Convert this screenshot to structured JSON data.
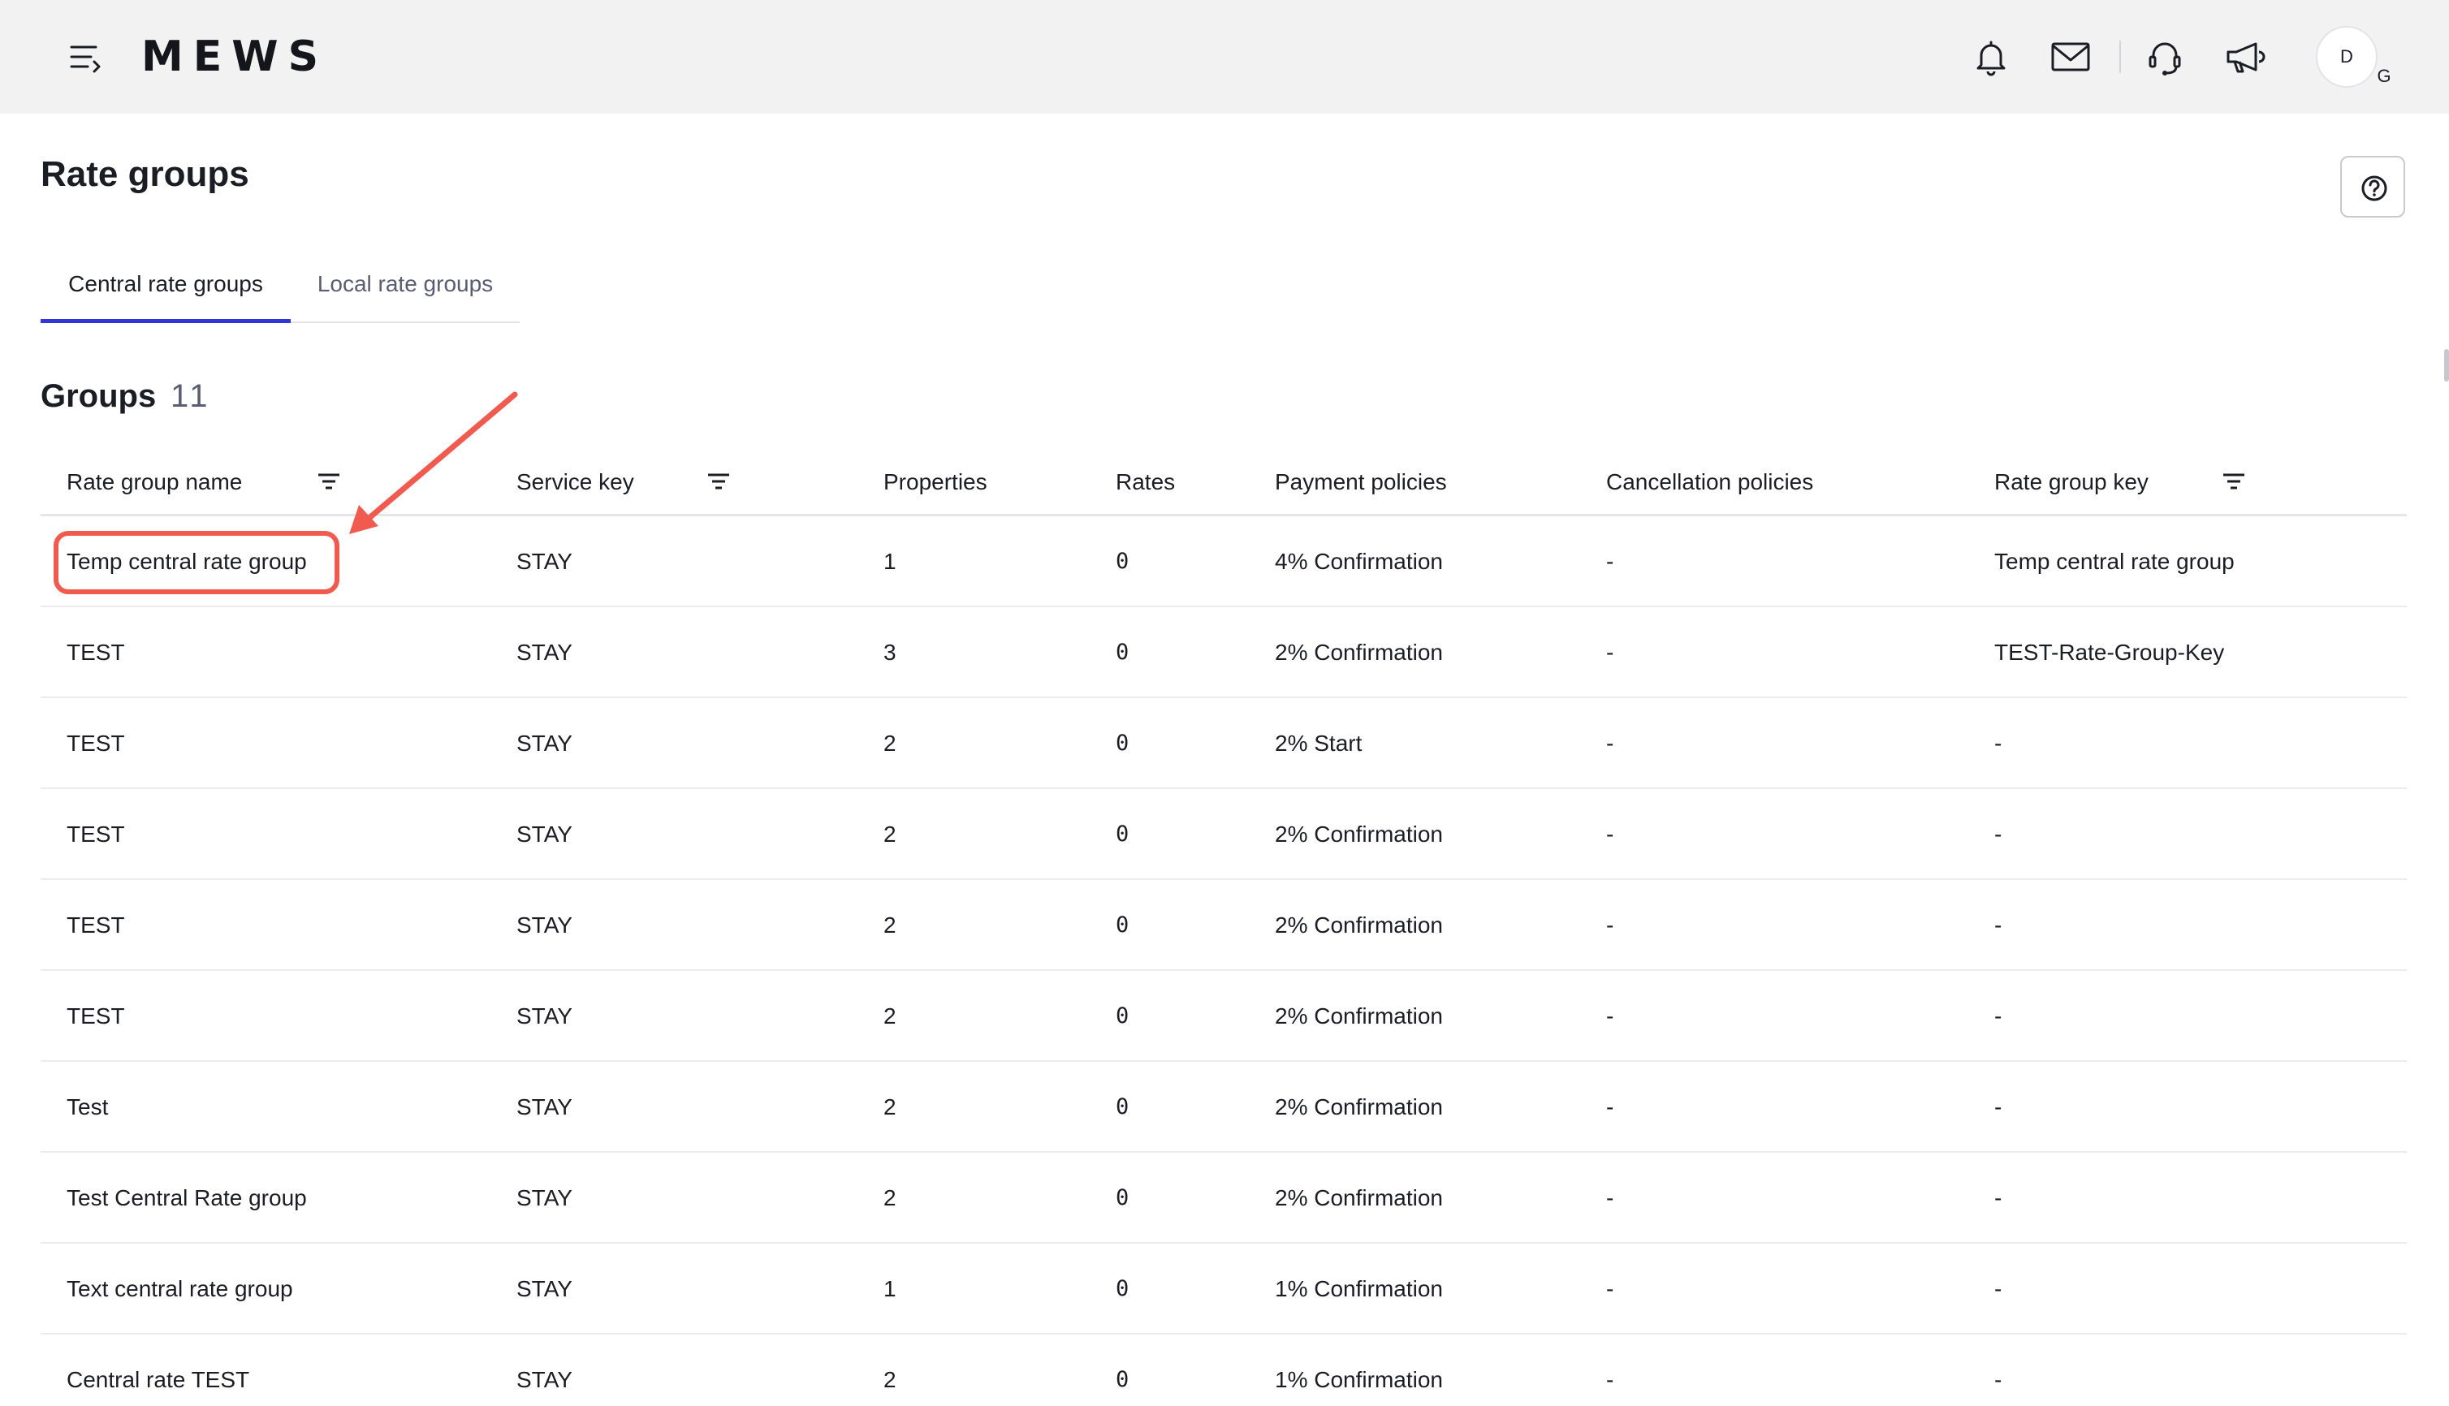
{
  "header": {
    "brand": "MEWS",
    "avatar_initial": "D",
    "avatar_sub": "G",
    "icons": [
      "menu-icon",
      "bell-icon",
      "mail-icon",
      "headset-icon",
      "megaphone-icon"
    ]
  },
  "page": {
    "title": "Rate groups"
  },
  "tabs": [
    {
      "label": "Central rate groups",
      "active": true
    },
    {
      "label": "Local rate groups",
      "active": false
    }
  ],
  "groups": {
    "title": "Groups",
    "count": "11"
  },
  "table": {
    "columns": [
      "Rate group name",
      "Service key",
      "Properties",
      "Rates",
      "Payment policies",
      "Cancellation policies",
      "Rate group key"
    ],
    "rows": [
      [
        "Temp central rate group",
        "STAY",
        "1",
        "0",
        "4% Confirmation",
        "-",
        "Temp central rate group"
      ],
      [
        "TEST",
        "STAY",
        "3",
        "0",
        "2% Confirmation",
        "-",
        "TEST-Rate-Group-Key"
      ],
      [
        "TEST",
        "STAY",
        "2",
        "0",
        "2% Start",
        "-",
        "-"
      ],
      [
        "TEST",
        "STAY",
        "2",
        "0",
        "2% Confirmation",
        "-",
        "-"
      ],
      [
        "TEST",
        "STAY",
        "2",
        "0",
        "2% Confirmation",
        "-",
        "-"
      ],
      [
        "TEST",
        "STAY",
        "2",
        "0",
        "2% Confirmation",
        "-",
        "-"
      ],
      [
        "Test",
        "STAY",
        "2",
        "0",
        "2% Confirmation",
        "-",
        "-"
      ],
      [
        "Test Central Rate group",
        "STAY",
        "2",
        "0",
        "2% Confirmation",
        "-",
        "-"
      ],
      [
        "Text central rate group",
        "STAY",
        "1",
        "0",
        "1% Confirmation",
        "-",
        "-"
      ],
      [
        "Central rate TEST",
        "STAY",
        "2",
        "0",
        "1% Confirmation",
        "-",
        "-"
      ]
    ]
  },
  "colors": {
    "accent": "#3236d6",
    "annotation": "#f05a4f",
    "topbar_bg": "#f2f2f3"
  }
}
